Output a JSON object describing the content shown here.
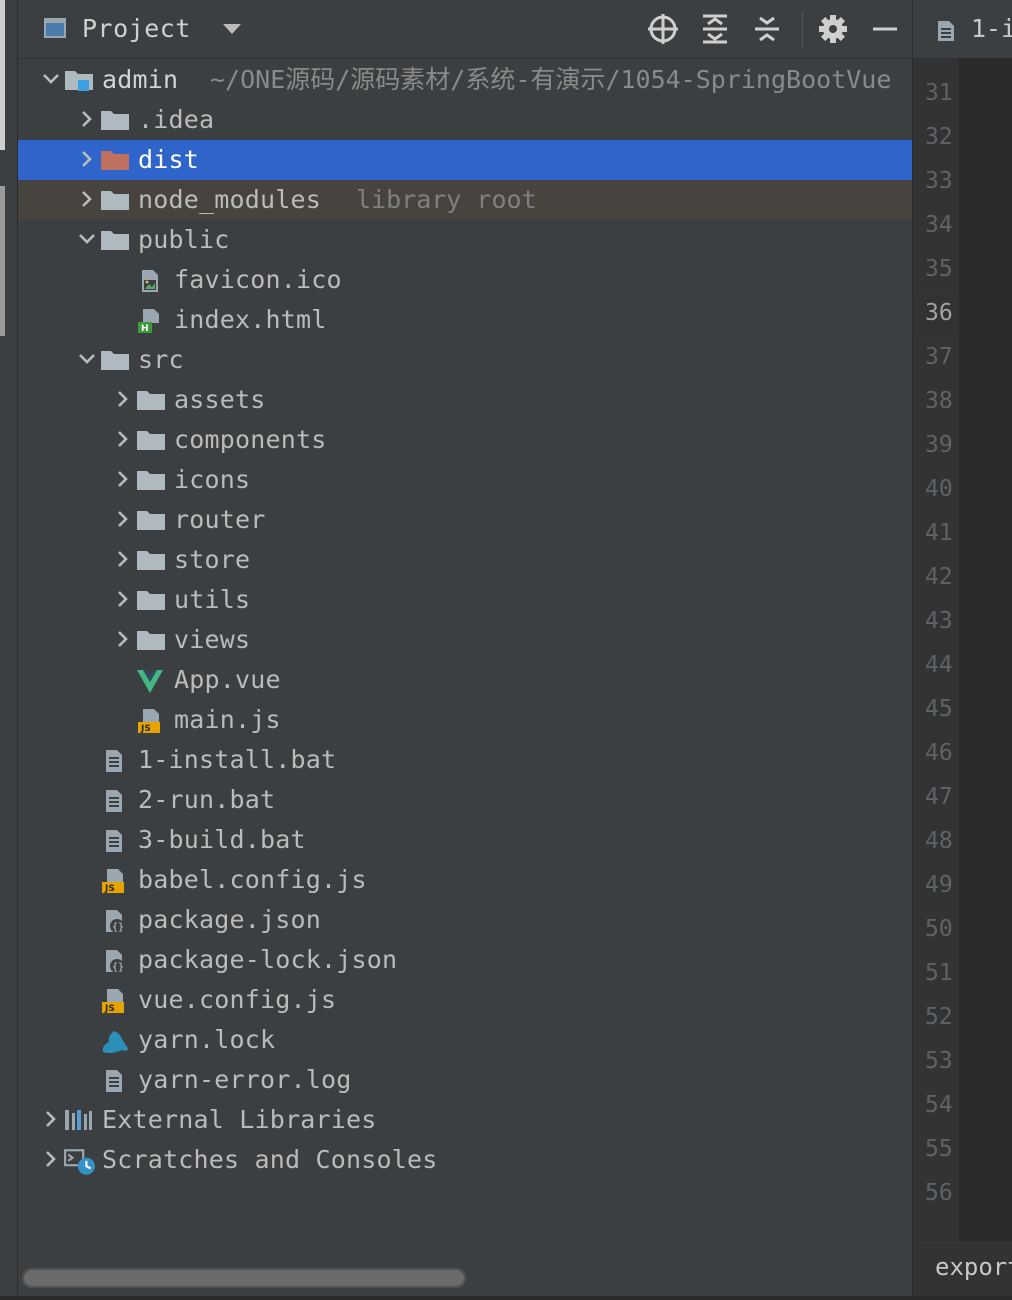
{
  "header": {
    "title": "Project"
  },
  "tree": [
    {
      "key": "admin",
      "label": "admin",
      "path": "~/ONE源码/源码素材/系统-有演示/1054-SpringBootVue",
      "chevron": "down",
      "icon": "module-folder-icon"
    },
    {
      "key": "idea",
      "label": ".idea",
      "chevron": "right",
      "icon": "folder-icon"
    },
    {
      "key": "dist",
      "label": "dist",
      "chevron": "right",
      "icon": "excluded-folder-icon"
    },
    {
      "key": "node_modules",
      "label": "node_modules",
      "hint": "library root",
      "chevron": "right",
      "icon": "folder-icon"
    },
    {
      "key": "public",
      "label": "public",
      "chevron": "down",
      "icon": "folder-icon"
    },
    {
      "key": "favicon",
      "label": "favicon.ico",
      "icon": "image-file-icon"
    },
    {
      "key": "index_html",
      "label": "index.html",
      "icon": "html-file-icon"
    },
    {
      "key": "src",
      "label": "src",
      "chevron": "down",
      "icon": "folder-icon"
    },
    {
      "key": "assets",
      "label": "assets",
      "chevron": "right",
      "icon": "folder-icon"
    },
    {
      "key": "components",
      "label": "components",
      "chevron": "right",
      "icon": "folder-icon"
    },
    {
      "key": "icons",
      "label": "icons",
      "chevron": "right",
      "icon": "folder-icon"
    },
    {
      "key": "router",
      "label": "router",
      "chevron": "right",
      "icon": "folder-icon"
    },
    {
      "key": "store",
      "label": "store",
      "chevron": "right",
      "icon": "folder-icon"
    },
    {
      "key": "utils",
      "label": "utils",
      "chevron": "right",
      "icon": "folder-icon"
    },
    {
      "key": "views",
      "label": "views",
      "chevron": "right",
      "icon": "folder-icon"
    },
    {
      "key": "app_vue",
      "label": "App.vue",
      "icon": "vue-file-icon"
    },
    {
      "key": "main_js",
      "label": "main.js",
      "icon": "js-file-icon"
    },
    {
      "key": "install_bat",
      "label": "1-install.bat",
      "icon": "text-file-icon"
    },
    {
      "key": "run_bat",
      "label": "2-run.bat",
      "icon": "text-file-icon"
    },
    {
      "key": "build_bat",
      "label": "3-build.bat",
      "icon": "text-file-icon"
    },
    {
      "key": "babel_config",
      "label": "babel.config.js",
      "icon": "js-file-icon"
    },
    {
      "key": "package_json",
      "label": "package.json",
      "icon": "json-file-icon"
    },
    {
      "key": "package_lock",
      "label": "package-lock.json",
      "icon": "json-file-icon"
    },
    {
      "key": "vue_config",
      "label": "vue.config.js",
      "icon": "js-file-icon"
    },
    {
      "key": "yarn_lock",
      "label": "yarn.lock",
      "icon": "yarn-file-icon"
    },
    {
      "key": "yarn_error",
      "label": "yarn-error.log",
      "icon": "text-file-icon"
    },
    {
      "key": "ext_libs",
      "label": "External Libraries",
      "chevron": "right",
      "icon": "libraries-icon"
    },
    {
      "key": "scratches",
      "label": "Scratches and Consoles",
      "chevron": "right",
      "icon": "scratches-icon"
    }
  ],
  "selected": "dist",
  "editor": {
    "tab_label": "1-i",
    "line_numbers": [
      "31",
      "32",
      "33",
      "34",
      "35",
      "36",
      "37",
      "38",
      "39",
      "40",
      "41",
      "42",
      "43",
      "44",
      "45",
      "46",
      "47",
      "48",
      "49",
      "50",
      "51",
      "52",
      "53",
      "54",
      "55",
      "56"
    ],
    "current_line": "36",
    "bottom_text": "export"
  },
  "colors": {
    "selection": "#2f65ca",
    "background": "#3c3f41",
    "folder": "#aeb9c0",
    "excluded_folder": "#c0705f"
  }
}
